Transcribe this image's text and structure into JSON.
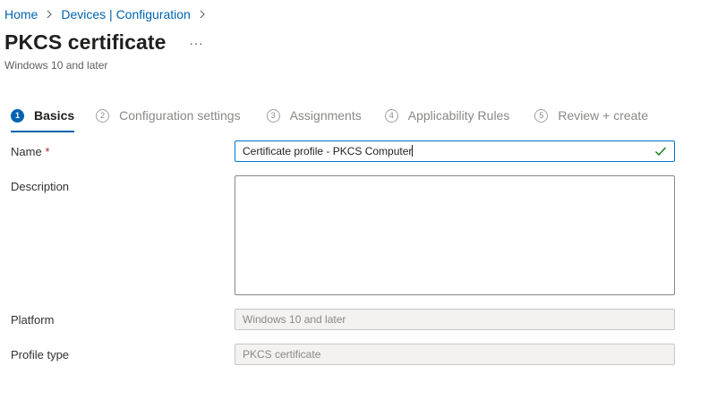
{
  "breadcrumb": {
    "items": [
      "Home",
      "Devices | Configuration"
    ]
  },
  "header": {
    "title": "PKCS certificate",
    "more_label": "···",
    "subtitle": "Windows 10 and later"
  },
  "wizard": {
    "steps": [
      {
        "number": "1",
        "label": "Basics",
        "active": true
      },
      {
        "number": "2",
        "label": "Configuration settings",
        "active": false
      },
      {
        "number": "3",
        "label": "Assignments",
        "active": false
      },
      {
        "number": "4",
        "label": "Applicability Rules",
        "active": false
      },
      {
        "number": "5",
        "label": "Review + create",
        "active": false
      }
    ]
  },
  "form": {
    "name": {
      "label": "Name",
      "required_marker": "*",
      "value": "Certificate profile - PKCS Computer",
      "valid": true
    },
    "description": {
      "label": "Description",
      "value": ""
    },
    "platform": {
      "label": "Platform",
      "value": "Windows 10 and later"
    },
    "profile_type": {
      "label": "Profile type",
      "value": "PKCS certificate"
    }
  },
  "colors": {
    "accent": "#0063b1",
    "focus_border": "#0078d4",
    "valid_check": "#107c10",
    "required": "#a4262c"
  }
}
